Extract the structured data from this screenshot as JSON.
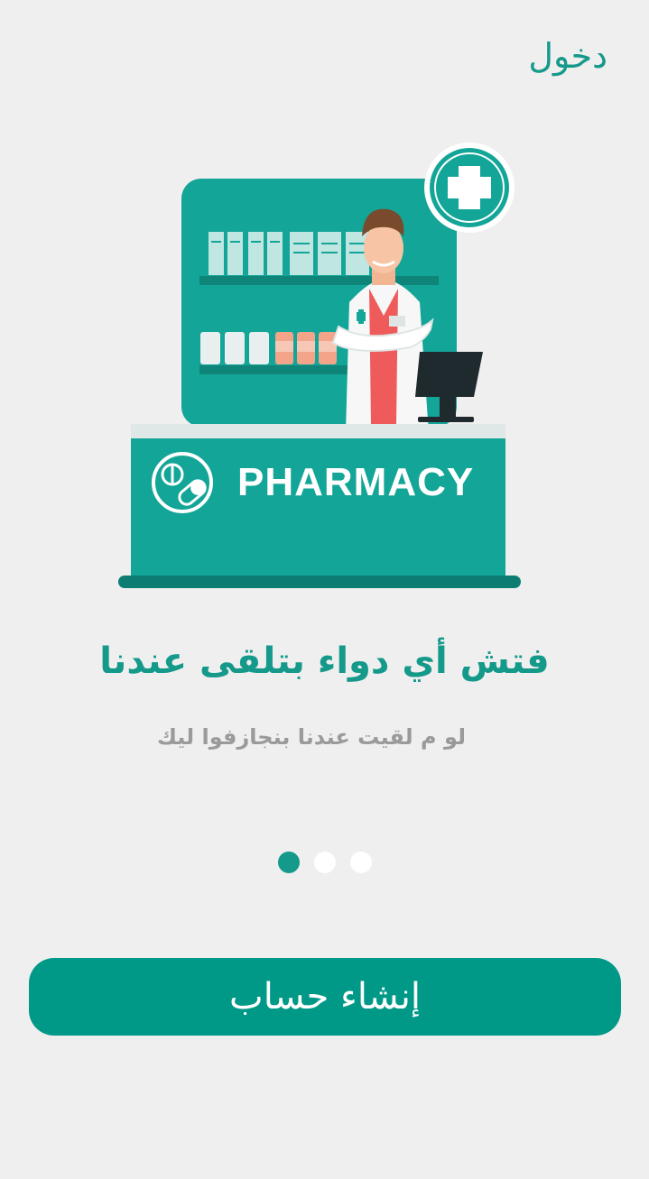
{
  "header": {
    "login_label": "دخول"
  },
  "illustration": {
    "icon": "pharmacy-illustration",
    "counter_text": "PHARMACY",
    "accent": "#13a597",
    "accent_dark": "#0d7d72"
  },
  "onboarding": {
    "title": "فتش أي دواء بتلقى عندنا",
    "subtitle": "لو م لقيت عندنا بنجازفوا ليك",
    "page_index": 1,
    "page_count": 3
  },
  "cta": {
    "label": "إنشاء حساب"
  },
  "colors": {
    "primary": "#009987",
    "background": "#efefef"
  }
}
